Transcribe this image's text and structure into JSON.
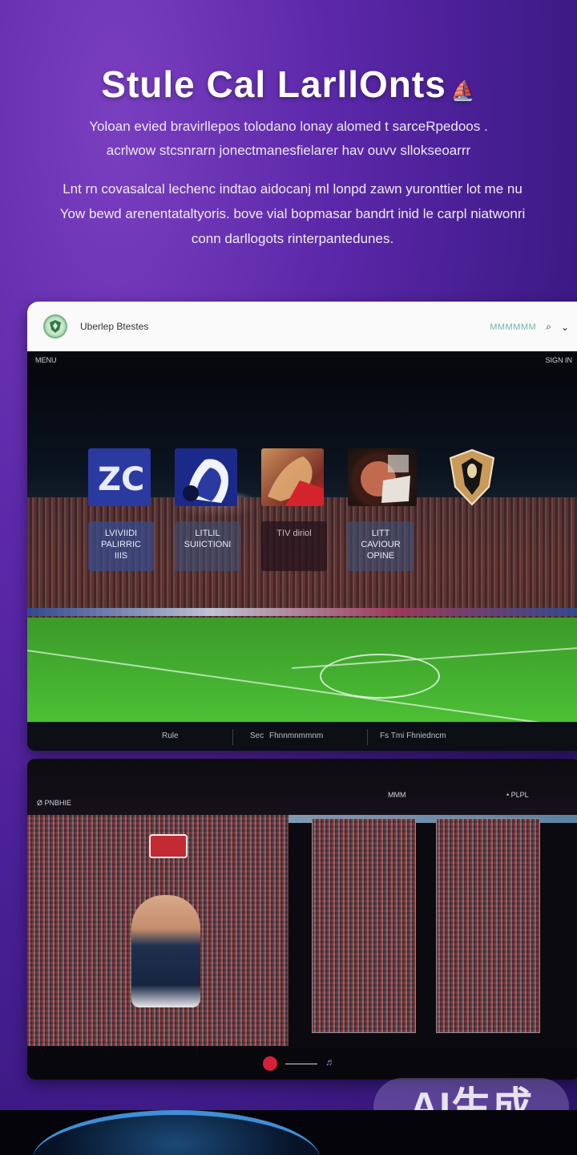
{
  "hero": {
    "title": "Stule Cal LarllOnts",
    "title_decor": "⛵",
    "subtitle_line1": "Yoloan evied bravirllepos tolodano lonay alomed t sarceRpedoos .",
    "subtitle_line2": "acrlwow stcsnrarn jonectmanesfielarer hav ouvv sllokseoarrr",
    "body_line1": "Lnt rn covasalcal lechenc indtao aidocanj ml lonpd zawn yuronttier lot me nu",
    "body_line2": "Yow bewd arenentataltyoris. bove vial bopmasar bandrt inid le carpl niatwonri",
    "body_line3": "conn darllogots rinterpantedunes."
  },
  "panel1": {
    "brand": "Uberlep Btestes",
    "header_link": "MMMMMM",
    "header_icon1": "⌕",
    "header_icon2": "⌄",
    "topbar_left": "MENU",
    "topbar_right": "SIGN IN",
    "tiles": [
      {
        "name": "tile-1",
        "text": "ZC"
      },
      {
        "name": "tile-2",
        "text": ""
      },
      {
        "name": "tile-3",
        "text": ""
      },
      {
        "name": "tile-4",
        "text": ""
      },
      {
        "name": "tile-5",
        "text": ""
      }
    ],
    "labels": [
      {
        "line1": "LVIVIIDI",
        "line2": "PALIRRIC",
        "line3": "IIIS"
      },
      {
        "line1": "LITLIL",
        "line2": "SUIICTIONI",
        "line3": ""
      },
      {
        "line1": "TIV diriol",
        "line2": "",
        "line3": ""
      },
      {
        "line1": "LITT",
        "line2": "CAVIOUR OPINE",
        "line3": ""
      }
    ],
    "footer": {
      "item1": "Rule",
      "item2": "Sec",
      "item3": "Fhnnmnmmnm",
      "item4": "Fs Tmi Fhniedncm"
    }
  },
  "panel2": {
    "topbar_left": "Ø PNBHIE",
    "topbar_mid": "MMM",
    "topbar_right": "• PLPL",
    "slider_icon": "♬"
  },
  "watermark": "AI生成",
  "colors": {
    "background": "#5a27a8",
    "accent": "#d6203a",
    "pitch": "#46b62e"
  }
}
